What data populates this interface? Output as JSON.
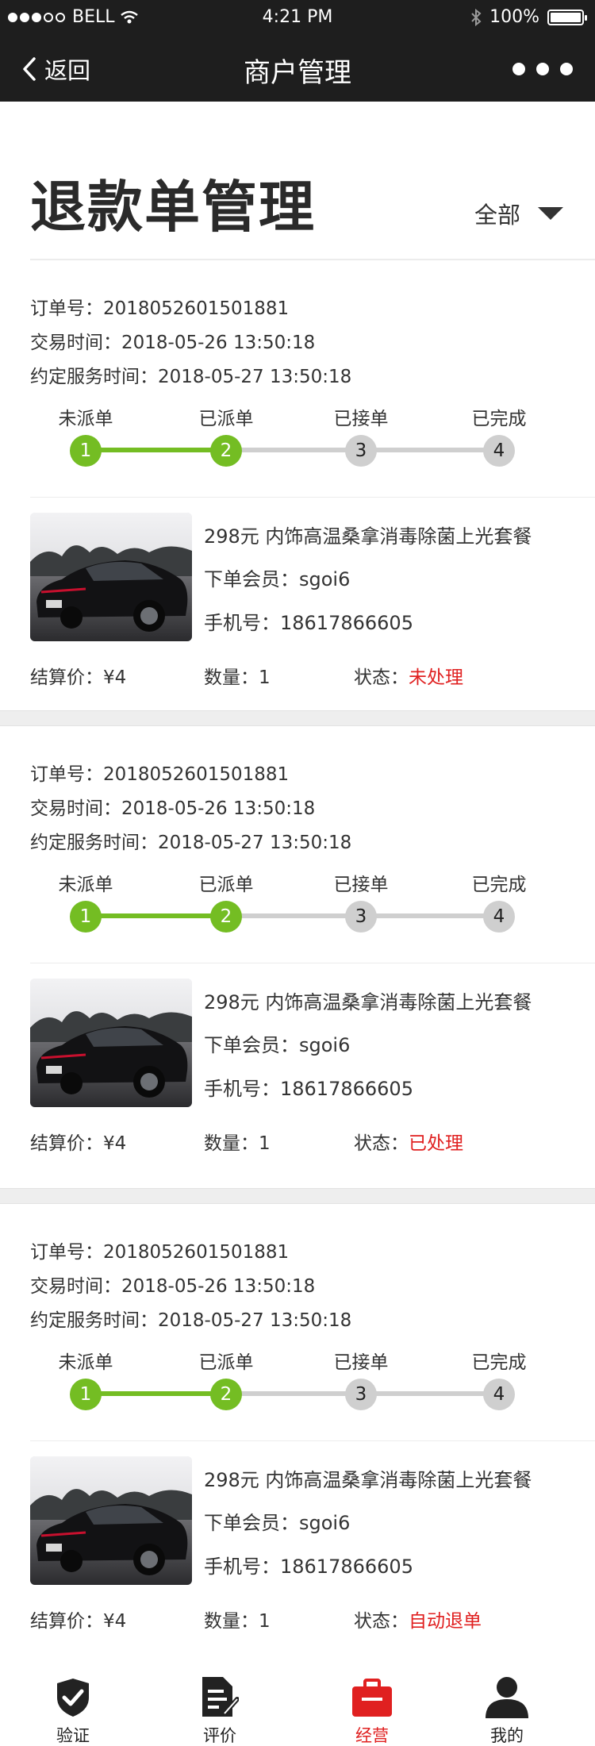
{
  "status_bar": {
    "carrier": "BELL",
    "time": "4:21 PM",
    "battery": "100%"
  },
  "nav": {
    "back_label": "返回",
    "title": "商户管理"
  },
  "page": {
    "title": "退款单管理",
    "filter_label": "全部"
  },
  "labels": {
    "order_no": "订单号：",
    "trade_time": "交易时间：",
    "service_time": "约定服务时间：",
    "member": "下单会员：",
    "phone": "手机号：",
    "price": "结算价：",
    "qty": "数量：",
    "state": "状态："
  },
  "steps": [
    {
      "label": "未派单",
      "num": "1"
    },
    {
      "label": "已派单",
      "num": "2"
    },
    {
      "label": "已接单",
      "num": "3"
    },
    {
      "label": "已完成",
      "num": "4"
    }
  ],
  "orders": [
    {
      "order_no": "2018052601501881",
      "trade_time": "2018-05-26 13:50:18",
      "service_time": "2018-05-27 13:50:18",
      "product": "298元 内饰高温桑拿消毒除菌上光套餐",
      "member": "sgoi6",
      "phone": "18617866605",
      "price": "¥4",
      "qty": "1",
      "state": "未处理",
      "progress": 2
    },
    {
      "order_no": "2018052601501881",
      "trade_time": "2018-05-26 13:50:18",
      "service_time": "2018-05-27 13:50:18",
      "product": "298元 内饰高温桑拿消毒除菌上光套餐",
      "member": "sgoi6",
      "phone": "18617866605",
      "price": "¥4",
      "qty": "1",
      "state": "已处理",
      "progress": 2
    },
    {
      "order_no": "2018052601501881",
      "trade_time": "2018-05-26 13:50:18",
      "service_time": "2018-05-27 13:50:18",
      "product": "298元 内饰高温桑拿消毒除菌上光套餐",
      "member": "sgoi6",
      "phone": "18617866605",
      "price": "¥4",
      "qty": "1",
      "state": "自动退单",
      "progress": 2
    }
  ],
  "tabbar": [
    {
      "label": "验证",
      "icon": "shield-check-icon"
    },
    {
      "label": "评价",
      "icon": "edit-document-icon"
    },
    {
      "label": "经营",
      "icon": "briefcase-icon",
      "active": true
    },
    {
      "label": "我的",
      "icon": "user-icon"
    }
  ],
  "colors": {
    "accent": "#e02020",
    "progress": "#74bd23",
    "pending": "#cfcfcf",
    "header_bg": "#1e1e1e"
  }
}
